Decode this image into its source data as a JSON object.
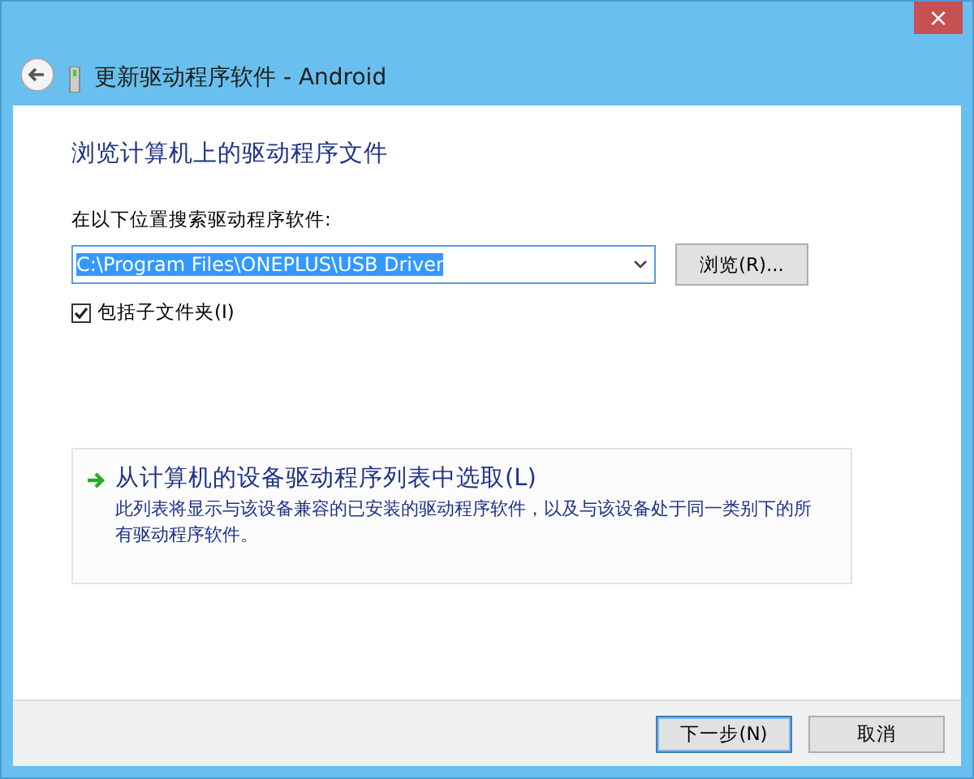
{
  "window": {
    "title": "更新驱动程序软件 - Android",
    "close": "×"
  },
  "heading": "浏览计算机上的驱动程序文件",
  "search": {
    "label": "在以下位置搜索驱动程序软件:",
    "value": "C:\\Program Files\\ONEPLUS\\USB Driver",
    "browse": "浏览(R)..."
  },
  "include_subfolders": {
    "label": "包括子文件夹(I)",
    "checked": true
  },
  "pick_option": {
    "title": "从计算机的设备驱动程序列表中选取(L)",
    "description": "此列表将显示与该设备兼容的已安装的驱动程序软件，以及与该设备处于同一类别下的所有驱动程序软件。"
  },
  "buttons": [
    {
      "label": "下一步(N)",
      "selected": true
    },
    {
      "label": "取消",
      "selected": false
    }
  ]
}
